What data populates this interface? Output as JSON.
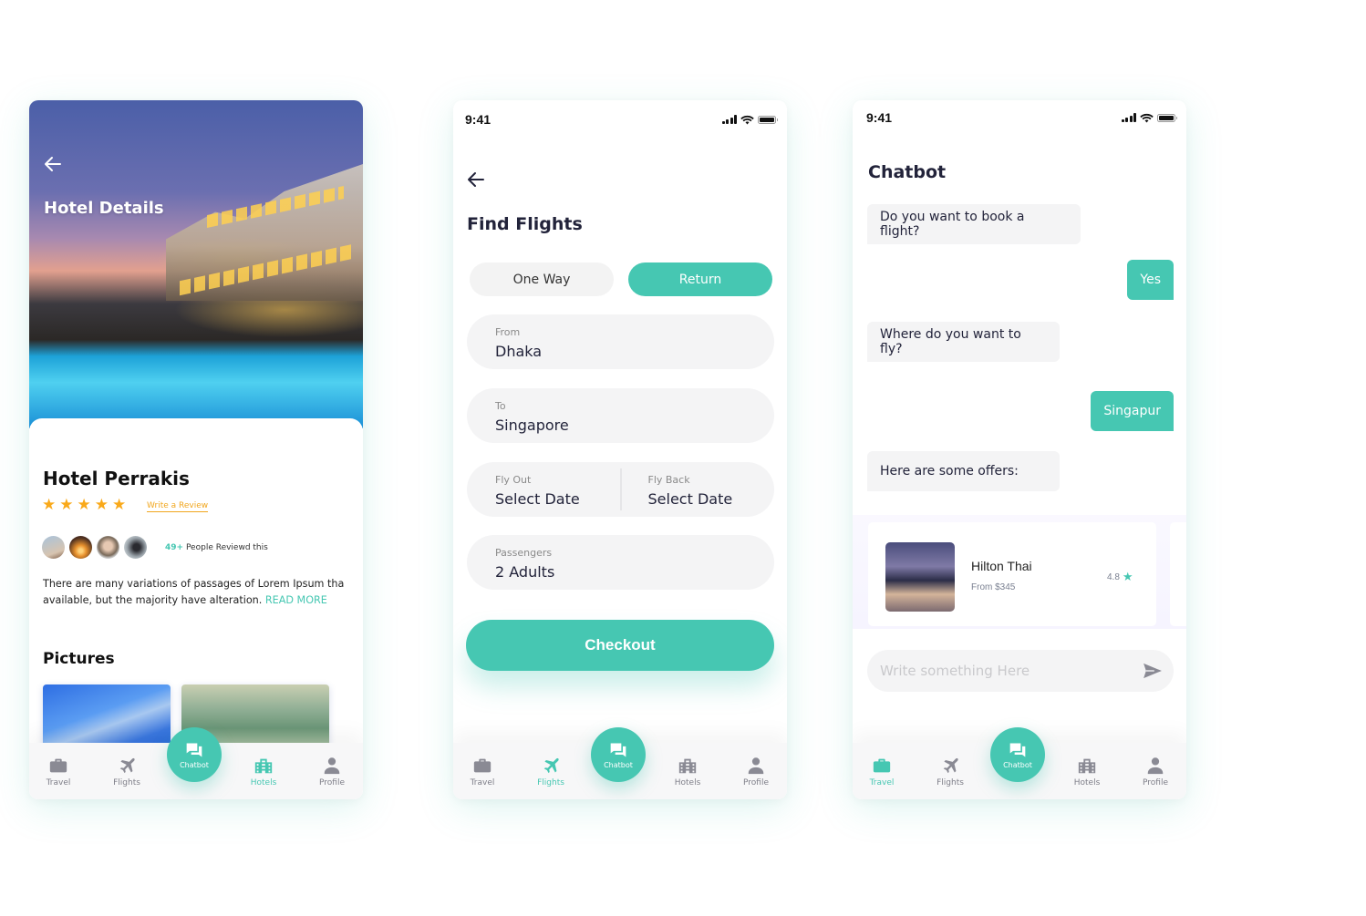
{
  "colors": {
    "accent": "#46c7b2",
    "star": "#f9a91a",
    "inactive": "#7e7e88",
    "field_bg": "#f4f4f5",
    "title": "#22233a"
  },
  "status_bar": {
    "time": "9:41"
  },
  "hotel_screen": {
    "header_title": "Hotel Details",
    "hotel_name": "Hotel Perrakis",
    "rating_stars": 5,
    "rating_max": 5,
    "write_review": "Write a Review",
    "review_count": "49+",
    "reviewed_text": "People Reviewd this",
    "description_line1": "There are many variations of passages of Lorem Ipsum tha",
    "description_line2": "available, but the majority have alteration.",
    "read_more": "READ MORE",
    "pictures_title": "Pictures"
  },
  "flights_screen": {
    "title": "Find Flights",
    "trip_type": {
      "one_way": "One Way",
      "return": "Return",
      "selected": "Return"
    },
    "from": {
      "label": "From",
      "value": "Dhaka"
    },
    "to": {
      "label": "To",
      "value": "Singapore"
    },
    "fly_out": {
      "label": "Fly Out",
      "value": "Select Date"
    },
    "fly_back": {
      "label": "Fly Back",
      "value": "Select Date"
    },
    "passengers": {
      "label": "Passengers",
      "value": "2 Adults"
    },
    "checkout": "Checkout"
  },
  "chat_screen": {
    "title": "Chatbot",
    "messages": [
      {
        "from": "bot",
        "text": "Do you want to book a flight?"
      },
      {
        "from": "user",
        "text": "Yes"
      },
      {
        "from": "bot",
        "text": "Where do you want to fly?"
      },
      {
        "from": "user",
        "text": "Singapur"
      },
      {
        "from": "bot",
        "text": "Here are some offers:"
      }
    ],
    "offer": {
      "name": "Hilton Thai",
      "price": "From $345",
      "rating": "4.8"
    },
    "input_placeholder": "Write something Here"
  },
  "bottom_nav": {
    "items": [
      {
        "label": "Travel",
        "icon": "briefcase-icon"
      },
      {
        "label": "Flights",
        "icon": "airplane-icon"
      },
      {
        "label": "Chatbot",
        "icon": "chat-bubbles-icon"
      },
      {
        "label": "Hotels",
        "icon": "building-icon"
      },
      {
        "label": "Profile",
        "icon": "user-icon"
      }
    ],
    "active": {
      "hotel_screen": "Hotels",
      "flights_screen": "Flights",
      "chat_screen": "Travel"
    }
  }
}
